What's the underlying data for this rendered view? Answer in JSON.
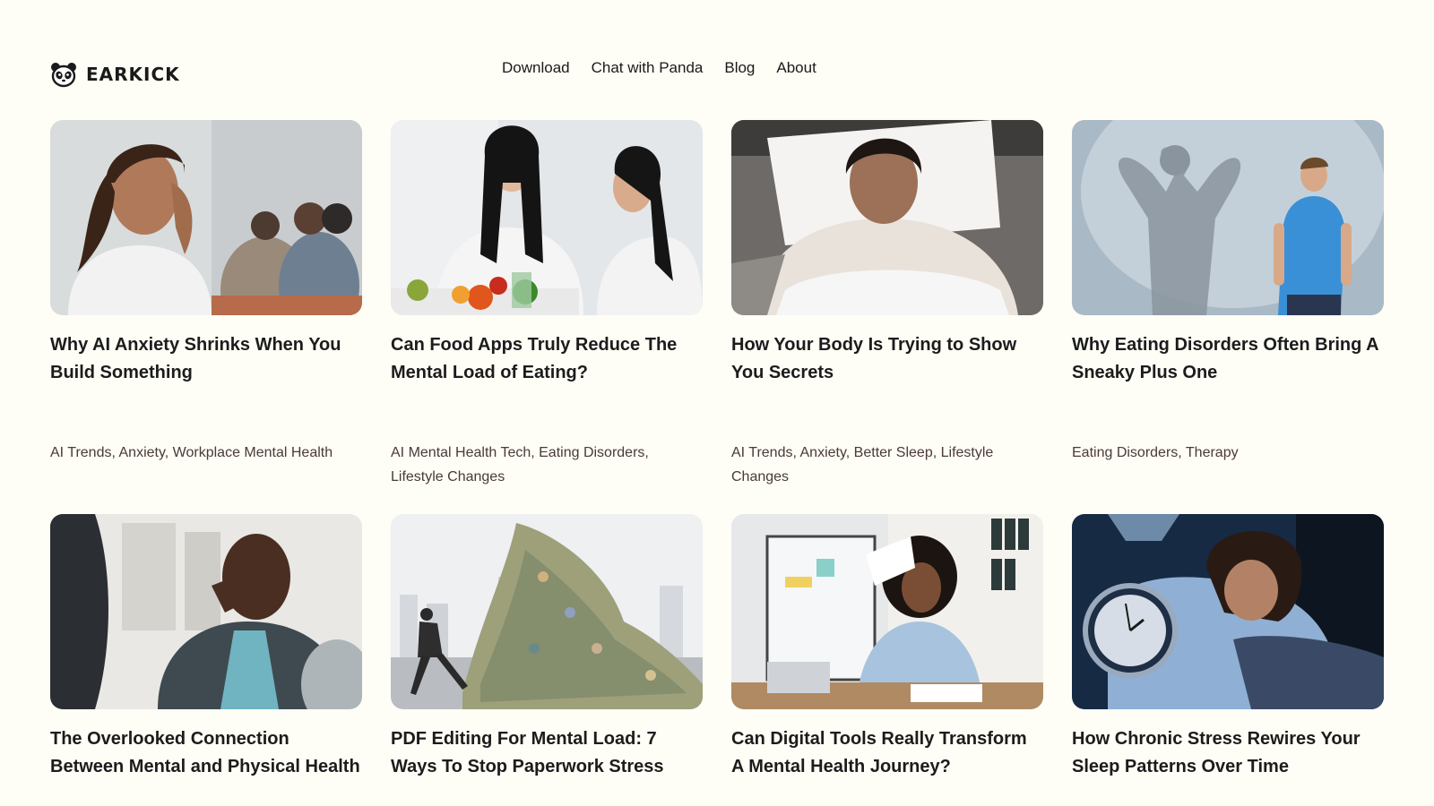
{
  "brand": {
    "name": "EARKICK",
    "logo_icon": "panda-icon"
  },
  "nav": {
    "items": [
      {
        "label": "Download"
      },
      {
        "label": "Chat with Panda"
      },
      {
        "label": "Blog"
      },
      {
        "label": "About"
      }
    ]
  },
  "posts": [
    {
      "title": "Why AI Anxiety Shrinks When You Build Something",
      "tags": [
        "AI Trends",
        "Anxiety",
        "Workplace Mental Health"
      ],
      "image": "woman-stressed-in-meeting-photo"
    },
    {
      "title": "Can Food Apps Truly Reduce The Mental Load of Eating?",
      "tags": [
        "AI Mental Health Tech",
        "Eating Disorders",
        "Lifestyle Changes"
      ],
      "image": "two-women-with-food-and-phone-photo"
    },
    {
      "title": "How Your Body Is Trying to Show You Secrets",
      "tags": [
        "AI Trends",
        "Anxiety",
        "Better Sleep",
        "Lifestyle Changes"
      ],
      "image": "woman-lying-in-bed-photo"
    },
    {
      "title": "Why Eating Disorders Often Bring A Sneaky Plus One",
      "tags": [
        "Eating Disorders",
        "Therapy"
      ],
      "image": "man-with-muscular-shadow-photo"
    },
    {
      "title": "The Overlooked Connection Between Mental and Physical Health",
      "tags": [],
      "image": "woman-thinking-in-therapy-photo"
    },
    {
      "title": "PDF Editing For Mental Load: 7 Ways To Stop Paperwork Stress",
      "tags": [],
      "image": "man-running-from-paper-wave-photo"
    },
    {
      "title": "Can Digital Tools Really Transform A Mental Health Journey?",
      "tags": [],
      "image": "overwhelmed-woman-at-desk-photo"
    },
    {
      "title": "How Chronic Stress Rewires Your Sleep Patterns Over Time",
      "tags": [],
      "image": "sleepless-woman-with-clock-photo"
    }
  ],
  "colors": {
    "background": "#fefdf6",
    "text": "#1c1c1c",
    "tag_text": "#4a3a3a"
  }
}
